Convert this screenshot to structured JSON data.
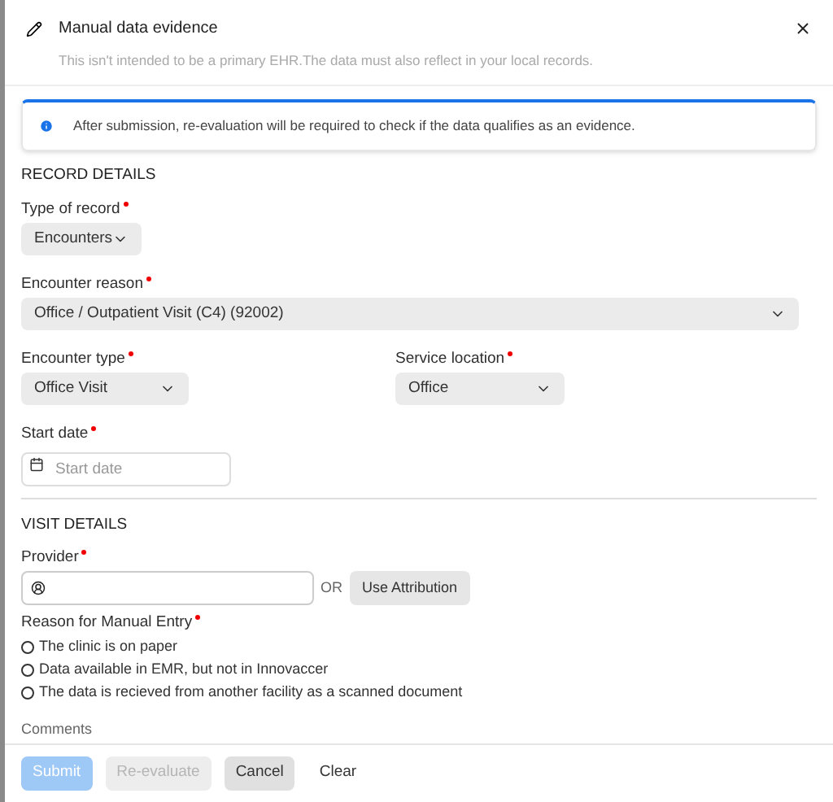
{
  "dialog": {
    "title": "Manual data evidence",
    "subtitle": "This isn't intended to be a primary EHR.The data must also reflect in your local records."
  },
  "info_banner": {
    "text": "After submission, re-evaluation will be required to check if the data qualifies as an evidence."
  },
  "record_details": {
    "heading": "RECORD DETAILS",
    "type_of_record": {
      "label": "Type of record",
      "required": true,
      "value": "Encounters"
    },
    "encounter_reason": {
      "label": "Encounter reason",
      "required": true,
      "value": "Office / Outpatient Visit (C4) (92002)"
    },
    "encounter_type": {
      "label": "Encounter type",
      "required": true,
      "value": "Office Visit"
    },
    "service_location": {
      "label": "Service location",
      "required": true,
      "value": "Office"
    },
    "start_date": {
      "label": "Start date",
      "required": true,
      "placeholder": "Start date"
    }
  },
  "visit_details": {
    "heading": "VISIT DETAILS",
    "provider": {
      "label": "Provider",
      "required": true,
      "or_text": "OR",
      "attribution_button": "Use Attribution"
    },
    "reason": {
      "label": "Reason for Manual Entry",
      "required": true,
      "options": [
        {
          "label": "The clinic is on paper",
          "selected": false
        },
        {
          "label": "Data available in EMR, but not in Innovaccer",
          "selected": false
        },
        {
          "label": "The data is recieved from another facility as a scanned document",
          "selected": false
        }
      ]
    },
    "comments_label": "Comments"
  },
  "footer_buttons": [
    {
      "label": "Submit",
      "kind": "primary",
      "disabled": true
    },
    {
      "label": "Re-evaluate",
      "kind": "secondary",
      "disabled": true
    },
    {
      "label": "Cancel",
      "kind": "secondary",
      "disabled": false
    },
    {
      "label": "Clear",
      "kind": "link",
      "disabled": false
    }
  ]
}
